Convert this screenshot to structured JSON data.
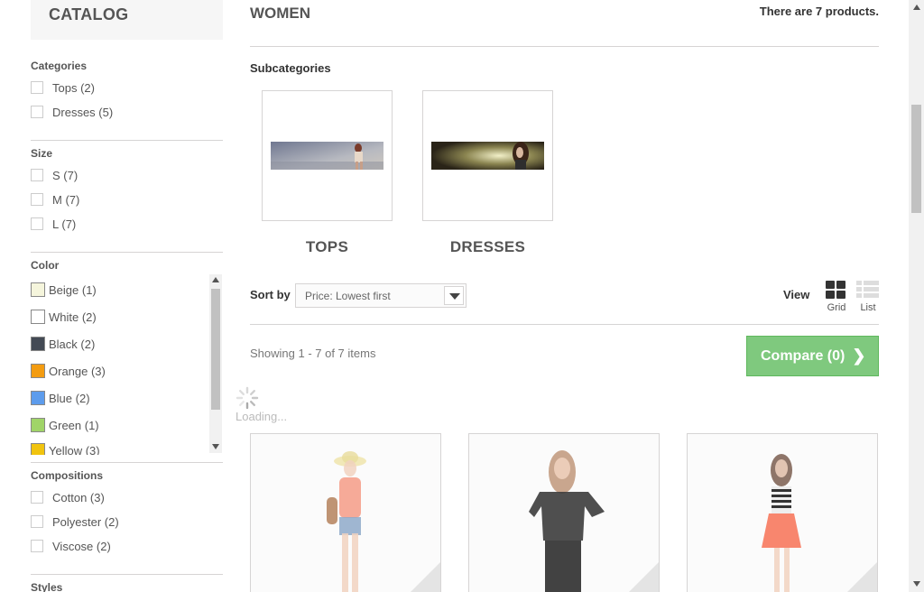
{
  "sidebar": {
    "catalog_title": "CATALOG",
    "categories": {
      "title": "Categories",
      "items": [
        "Tops (2)",
        "Dresses (5)"
      ]
    },
    "size": {
      "title": "Size",
      "items": [
        "S (7)",
        "M (7)",
        "L (7)"
      ]
    },
    "color": {
      "title": "Color",
      "items": [
        {
          "label": "Beige (1)",
          "color": "#f5f5dc"
        },
        {
          "label": "White (2)",
          "color": "#ffffff"
        },
        {
          "label": "Black (2)",
          "color": "#434a54"
        },
        {
          "label": "Orange (3)",
          "color": "#f39c11"
        },
        {
          "label": "Blue (2)",
          "color": "#5d9cec"
        },
        {
          "label": "Green (1)",
          "color": "#a0d468"
        },
        {
          "label": "Yellow (3)",
          "color": "#f1c40f"
        }
      ]
    },
    "compositions": {
      "title": "Compositions",
      "items": [
        "Cotton (3)",
        "Polyester (2)",
        "Viscose (2)"
      ]
    },
    "styles": {
      "title": "Styles"
    }
  },
  "main": {
    "category_name": "WOMEN",
    "product_count": "There are 7 products.",
    "subcategories_title": "Subcategories",
    "subcategories": [
      "TOPS",
      "DRESSES"
    ],
    "sort": {
      "label": "Sort by",
      "value": "Price: Lowest first"
    },
    "view": {
      "label": "View",
      "grid_label": "Grid",
      "list_label": "List"
    },
    "showing": "Showing 1 - 7 of 7 items",
    "compare": {
      "label": "Compare (0)",
      "color": "#7fc97e"
    },
    "loading": "Loading..."
  }
}
